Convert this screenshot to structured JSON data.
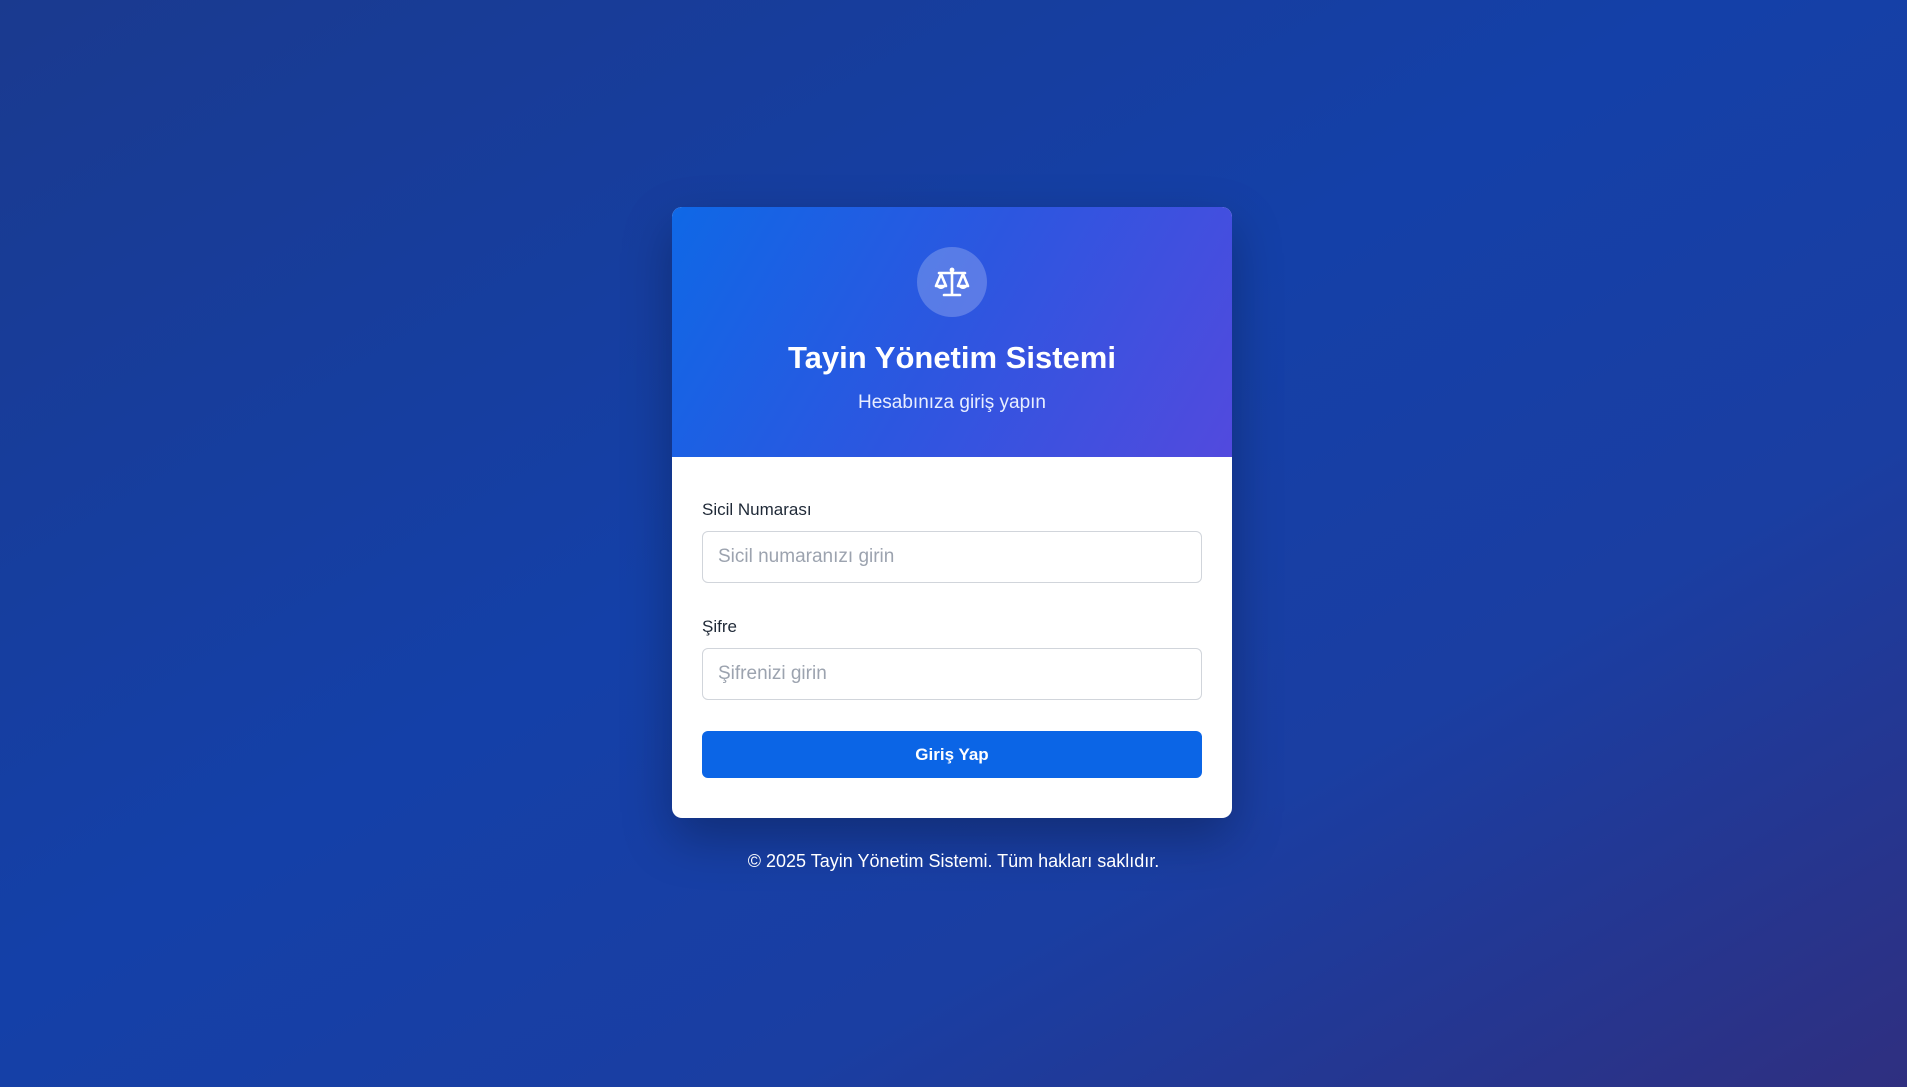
{
  "header": {
    "logo_icon": "balance-scale-icon",
    "title": "Tayin Yönetim Sistemi",
    "subtitle": "Hesabınıza giriş yapın"
  },
  "form": {
    "registry_label": "Sicil Numarası",
    "registry_placeholder": "Sicil numaranızı girin",
    "registry_value": "",
    "password_label": "Şifre",
    "password_placeholder": "Şifrenizi girin",
    "password_value": "",
    "submit_label": "Giriş Yap"
  },
  "footer": {
    "copyright": "© 2025 Tayin Yönetim Sistemi. Tüm hakları saklıdır."
  },
  "colors": {
    "primary": "#0b65e6",
    "header_gradient_start": "#0f68e6",
    "header_gradient_end": "#524ade",
    "background": "#1440a8"
  }
}
